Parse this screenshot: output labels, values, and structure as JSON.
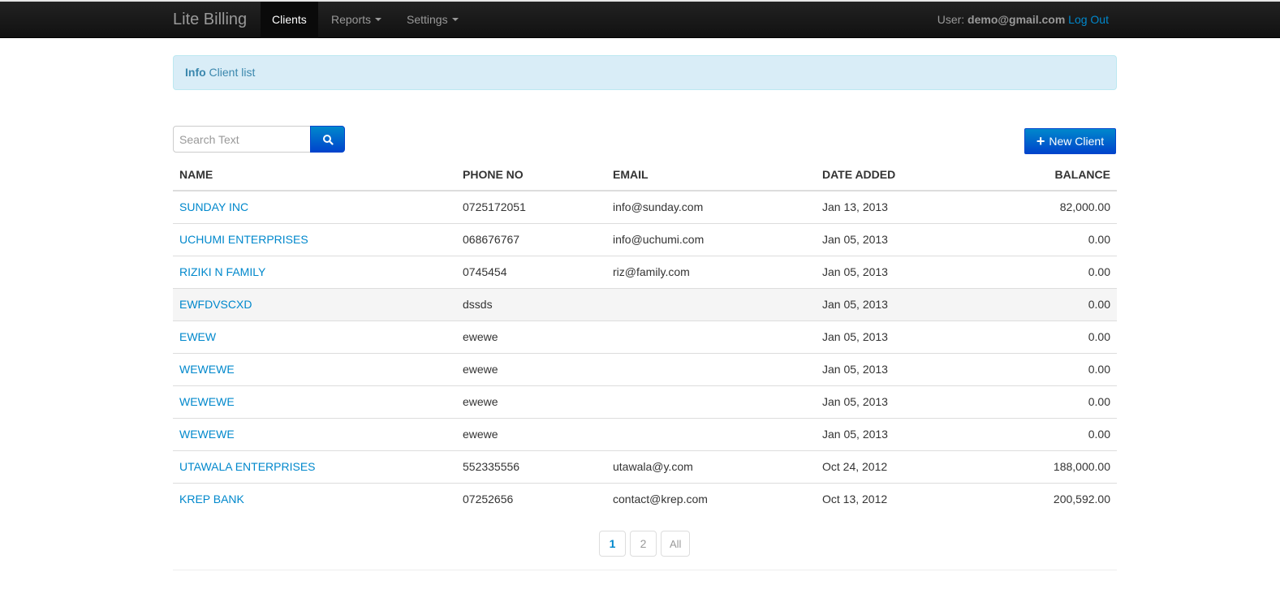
{
  "navbar": {
    "brand": "Lite Billing",
    "items": [
      {
        "label": "Clients",
        "active": true,
        "dropdown": false
      },
      {
        "label": "Reports",
        "active": false,
        "dropdown": true
      },
      {
        "label": "Settings",
        "active": false,
        "dropdown": true
      }
    ],
    "user_prefix": "User:",
    "user_email": "demo@gmail.com",
    "logout_label": "Log Out"
  },
  "alert": {
    "title": "Info",
    "message": "Client list"
  },
  "search": {
    "placeholder": "Search Text",
    "value": "",
    "button_icon": "search-icon"
  },
  "new_client_button": {
    "icon": "plus-icon",
    "label": "New Client"
  },
  "table": {
    "columns": [
      "NAME",
      "PHONE NO",
      "EMAIL",
      "DATE ADDED",
      "BALANCE"
    ],
    "rows": [
      {
        "name": "SUNDAY INC",
        "phone": "0725172051",
        "email": "info@sunday.com",
        "date": "Jan 13, 2013",
        "balance": "82,000.00"
      },
      {
        "name": "UCHUMI ENTERPRISES",
        "phone": "068676767",
        "email": "info@uchumi.com",
        "date": "Jan 05, 2013",
        "balance": "0.00"
      },
      {
        "name": "RIZIKI N FAMILY",
        "phone": "0745454",
        "email": "riz@family.com",
        "date": "Jan 05, 2013",
        "balance": "0.00"
      },
      {
        "name": "EWFDVSCXD",
        "phone": "dssds",
        "email": "",
        "date": "Jan 05, 2013",
        "balance": "0.00",
        "hover": true
      },
      {
        "name": "EWEW",
        "phone": "ewewe",
        "email": "",
        "date": "Jan 05, 2013",
        "balance": "0.00"
      },
      {
        "name": "WEWEWE",
        "phone": "ewewe",
        "email": "",
        "date": "Jan 05, 2013",
        "balance": "0.00"
      },
      {
        "name": "WEWEWE",
        "phone": "ewewe",
        "email": "",
        "date": "Jan 05, 2013",
        "balance": "0.00"
      },
      {
        "name": "WEWEWE",
        "phone": "ewewe",
        "email": "",
        "date": "Jan 05, 2013",
        "balance": "0.00"
      },
      {
        "name": "UTAWALA ENTERPRISES",
        "phone": "552335556",
        "email": "utawala@y.com",
        "date": "Oct 24, 2012",
        "balance": "188,000.00"
      },
      {
        "name": "KREP BANK",
        "phone": "07252656",
        "email": "contact@krep.com",
        "date": "Oct 13, 2012",
        "balance": "200,592.00"
      }
    ]
  },
  "pagination": {
    "pages": [
      "1",
      "2",
      "All"
    ],
    "current": "1"
  },
  "colors": {
    "navbar_bg": "#1b1b1b",
    "link": "#0088cc",
    "primary_button": "#0055cc",
    "alert_bg": "#d9edf7",
    "alert_text": "#3a87ad"
  }
}
